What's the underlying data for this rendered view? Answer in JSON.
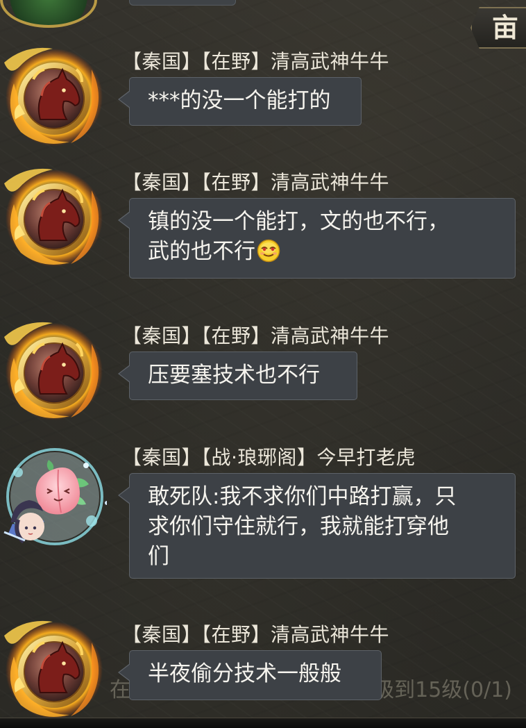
{
  "top_right": {
    "glyph": "亩"
  },
  "messages": [
    {
      "avatar": "dragon-horse-avatar",
      "nation": "【秦国】",
      "group": "【在野】",
      "player": "清高武神牛牛",
      "lines": [
        "***的没一个能打的"
      ]
    },
    {
      "avatar": "dragon-horse-avatar",
      "nation": "【秦国】",
      "group": "【在野】",
      "player": "清高武神牛牛",
      "lines": [
        "镇的没一个能打，文的也不行，",
        "武的也不行"
      ],
      "emoji": "smug-face-emoji"
    },
    {
      "avatar": "dragon-horse-avatar",
      "nation": "【秦国】",
      "group": "【在野】",
      "player": "清高武神牛牛",
      "lines": [
        "压要塞技术也不行"
      ]
    },
    {
      "avatar": "peach-girl-avatar",
      "nation": "【秦国】",
      "group": "【战·琅琊阁】",
      "player": "今早打老虎",
      "lines": [
        "敢死队:我不求你们中路打赢，只",
        "求你们守住就行，我就能打穿他",
        "们"
      ]
    },
    {
      "avatar": "dragon-horse-avatar",
      "nation": "【秦国】",
      "group": "【在野】",
      "player": "清高武神牛牛",
      "lines": [
        "半夜偷分技术一般般"
      ]
    }
  ],
  "background_quest": {
    "left": "在",
    "right": "级到15级(0/1)"
  },
  "colors": {
    "bubble_bg": "#3d4146",
    "bubble_border": "#5d6268",
    "name_text": "#ece7da",
    "message_text": "#f6f4ee",
    "avatar_frame_gold": "#d8a43a",
    "background": "#2c2b26"
  }
}
